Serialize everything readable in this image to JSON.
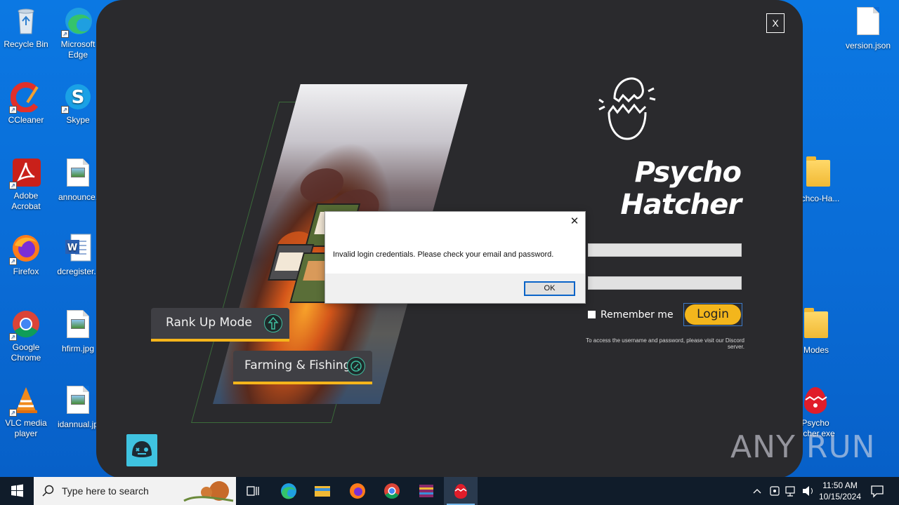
{
  "desktop": {
    "left_icons": [
      {
        "label": "Recycle Bin",
        "icon": "recycle-bin-icon"
      },
      {
        "label": "Microsoft Edge",
        "icon": "edge-icon"
      },
      {
        "label": "CCleaner",
        "icon": "ccleaner-icon"
      },
      {
        "label": "Skype",
        "icon": "skype-icon"
      },
      {
        "label": "Adobe Acrobat",
        "icon": "acrobat-icon"
      },
      {
        "label": "announce.",
        "icon": "image-file-icon"
      },
      {
        "label": "Firefox",
        "icon": "firefox-icon"
      },
      {
        "label": "dcregister.r",
        "icon": "word-doc-icon"
      },
      {
        "label": "Google Chrome",
        "icon": "chrome-icon"
      },
      {
        "label": "hfirm.jpg",
        "icon": "image-file-icon"
      },
      {
        "label": "VLC media player",
        "icon": "vlc-icon"
      },
      {
        "label": "idannual.jp",
        "icon": "image-file-icon"
      }
    ],
    "right_icons": [
      {
        "label": "version.json",
        "icon": "json-file-icon"
      },
      {
        "label": "ychco-Ha...",
        "icon": "folder-icon"
      },
      {
        "label": "Modes",
        "icon": "folder-icon"
      },
      {
        "label": "Psycho\natcher.exe",
        "icon": "psycho-hatcher-exe-icon"
      }
    ]
  },
  "app": {
    "close_label": "X",
    "brand": "Psycho Hatcher",
    "modes": [
      {
        "label": "Rank Up Mode"
      },
      {
        "label": "Farming & Fishing"
      }
    ],
    "remember_label": "Remember me",
    "login_label": "Login",
    "hint": "To access the username and password, please visit our Discord server.",
    "accent_color": "#f3b61c"
  },
  "dialog": {
    "message": "Invalid login credentials. Please check your email and password.",
    "ok_label": "OK"
  },
  "watermark": "ANY RUN",
  "taskbar": {
    "search_placeholder": "Type here to search",
    "time": "11:50 AM",
    "date": "10/15/2024"
  }
}
